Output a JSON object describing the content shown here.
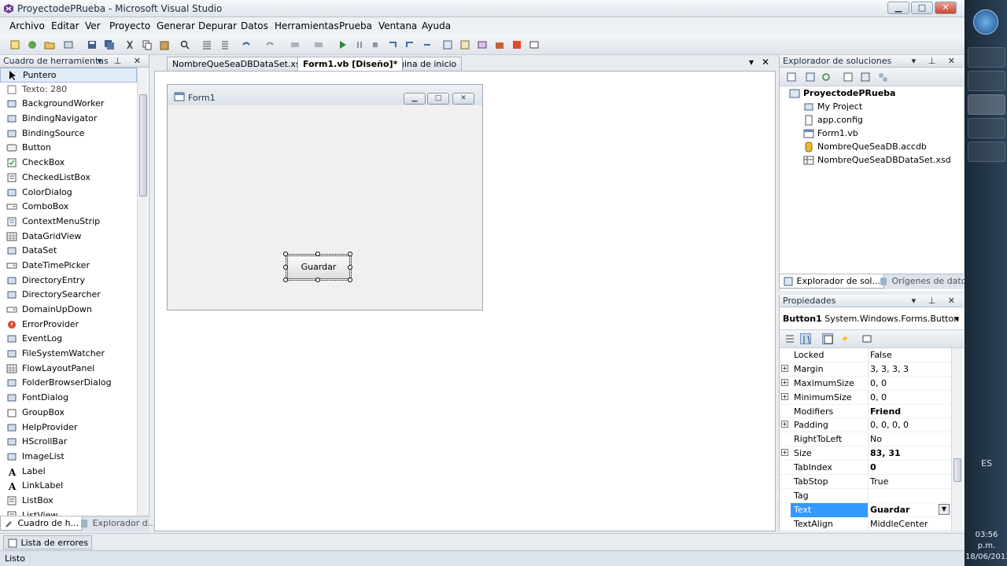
{
  "window": {
    "title": "ProyectodePRueba - Microsoft Visual Studio",
    "minimize": "▁",
    "maximize": "□",
    "close": "✕"
  },
  "menu": [
    "Archivo",
    "Editar",
    "Ver",
    "Proyecto",
    "Generar",
    "Depurar",
    "Datos",
    "Herramientas",
    "Prueba",
    "Ventana",
    "Ayuda"
  ],
  "toolbox": {
    "title": "Cuadro de herramientas",
    "items": [
      {
        "label": "Puntero",
        "icon": "pointer-icon"
      },
      {
        "label": "Texto: 280",
        "icon": "text-icon"
      },
      {
        "label": "BackgroundWorker",
        "icon": "component-icon"
      },
      {
        "label": "BindingNavigator",
        "icon": "component-icon"
      },
      {
        "label": "BindingSource",
        "icon": "component-icon"
      },
      {
        "label": "Button",
        "icon": "button-icon"
      },
      {
        "label": "CheckBox",
        "icon": "checkbox-icon"
      },
      {
        "label": "CheckedListBox",
        "icon": "list-icon"
      },
      {
        "label": "ColorDialog",
        "icon": "component-icon"
      },
      {
        "label": "ComboBox",
        "icon": "combo-icon"
      },
      {
        "label": "ContextMenuStrip",
        "icon": "menu-icon"
      },
      {
        "label": "DataGridView",
        "icon": "grid-icon"
      },
      {
        "label": "DataSet",
        "icon": "component-icon"
      },
      {
        "label": "DateTimePicker",
        "icon": "combo-icon"
      },
      {
        "label": "DirectoryEntry",
        "icon": "component-icon"
      },
      {
        "label": "DirectorySearcher",
        "icon": "component-icon"
      },
      {
        "label": "DomainUpDown",
        "icon": "combo-icon"
      },
      {
        "label": "ErrorProvider",
        "icon": "error-icon"
      },
      {
        "label": "EventLog",
        "icon": "component-icon"
      },
      {
        "label": "FileSystemWatcher",
        "icon": "component-icon"
      },
      {
        "label": "FlowLayoutPanel",
        "icon": "grid-icon"
      },
      {
        "label": "FolderBrowserDialog",
        "icon": "component-icon"
      },
      {
        "label": "FontDialog",
        "icon": "component-icon"
      },
      {
        "label": "GroupBox",
        "icon": "group-icon"
      },
      {
        "label": "HelpProvider",
        "icon": "component-icon"
      },
      {
        "label": "HScrollBar",
        "icon": "component-icon"
      },
      {
        "label": "ImageList",
        "icon": "component-icon"
      },
      {
        "label": "Label",
        "icon": "label-icon"
      },
      {
        "label": "LinkLabel",
        "icon": "label-icon"
      },
      {
        "label": "ListBox",
        "icon": "list-icon"
      },
      {
        "label": "ListView",
        "icon": "list-icon"
      }
    ],
    "tabs": [
      "Cuadro de h...",
      "Explorador d..."
    ]
  },
  "document": {
    "tabs": [
      "NombreQueSeaDBDataSet.xsd*",
      "Form1.vb [Diseño]*",
      "Página de inicio"
    ],
    "close_glyph": "✕",
    "dropdown_glyph": "▾"
  },
  "form1": {
    "title": "Form1",
    "button_label": "Guardar"
  },
  "solution_explorer": {
    "title": "Explorador de soluciones",
    "root": "ProyectodePRueba",
    "items": [
      "My Project",
      "app.config",
      "Form1.vb",
      "NombreQueSeaDB.accdb",
      "NombreQueSeaDBDataSet.xsd"
    ],
    "tabs": [
      "Explorador de sol...",
      "Orígenes de datos"
    ]
  },
  "properties": {
    "title": "Propiedades",
    "object_name": "Button1",
    "object_type": "System.Windows.Forms.Button",
    "rows": [
      {
        "name": "Locked",
        "value": "False",
        "expandable": false,
        "bold": false
      },
      {
        "name": "Margin",
        "value": "3, 3, 3, 3",
        "expandable": true,
        "bold": false
      },
      {
        "name": "MaximumSize",
        "value": "0, 0",
        "expandable": true,
        "bold": false
      },
      {
        "name": "MinimumSize",
        "value": "0, 0",
        "expandable": true,
        "bold": false
      },
      {
        "name": "Modifiers",
        "value": "Friend",
        "expandable": false,
        "bold": true
      },
      {
        "name": "Padding",
        "value": "0, 0, 0, 0",
        "expandable": true,
        "bold": false
      },
      {
        "name": "RightToLeft",
        "value": "No",
        "expandable": false,
        "bold": false
      },
      {
        "name": "Size",
        "value": "83, 31",
        "expandable": true,
        "bold": true
      },
      {
        "name": "TabIndex",
        "value": "0",
        "expandable": false,
        "bold": true
      },
      {
        "name": "TabStop",
        "value": "True",
        "expandable": false,
        "bold": false
      },
      {
        "name": "Tag",
        "value": "",
        "expandable": false,
        "bold": false
      },
      {
        "name": "Text",
        "value": "Guardar",
        "expandable": false,
        "bold": true,
        "selected": true
      },
      {
        "name": "TextAlign",
        "value": "MiddleCenter",
        "expandable": false,
        "bold": false
      }
    ]
  },
  "error_list_tab": "Lista de errores",
  "status_text": "Listo",
  "taskbar": {
    "language": "ES",
    "time": "03:56 p.m.",
    "date": "18/06/2012"
  }
}
